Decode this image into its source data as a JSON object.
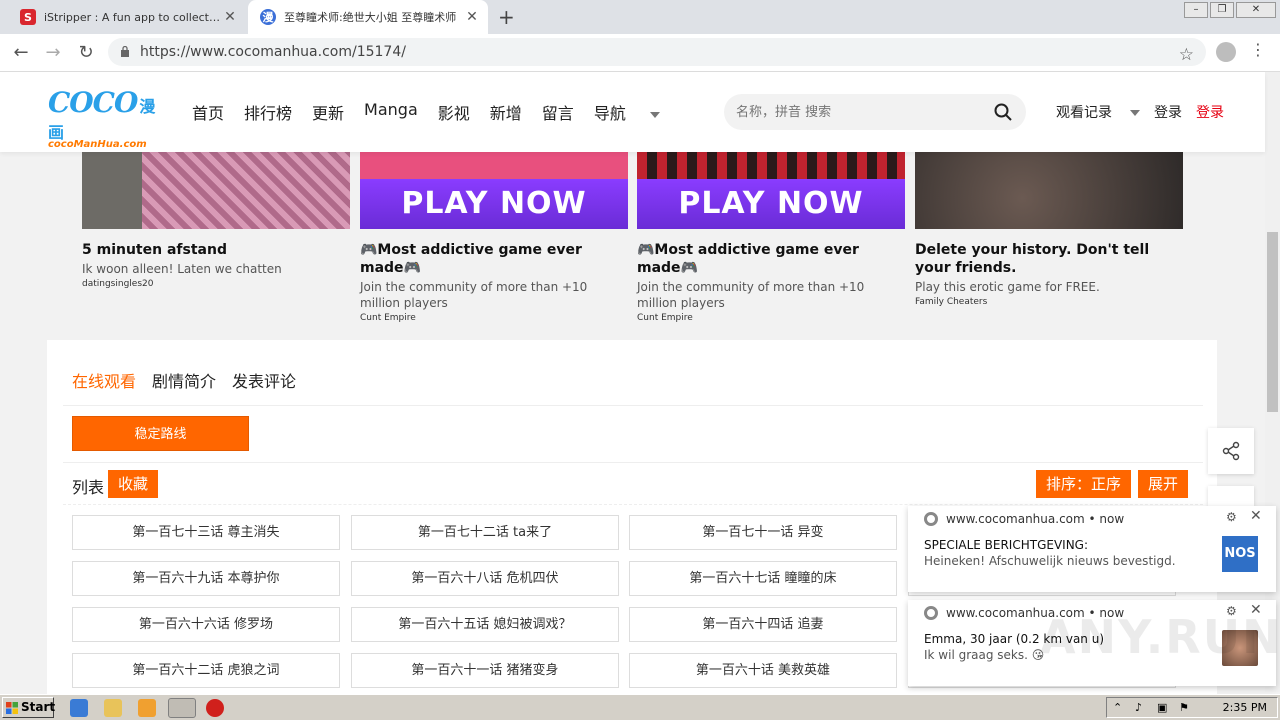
{
  "browser": {
    "tabs": [
      {
        "title": "iStripper : A fun app to collect and w",
        "active": false
      },
      {
        "title": "至尊瞳术师:绝世大小姐 至尊瞳术师",
        "active": true
      }
    ],
    "url": "https://www.cocomanhua.com/15174/"
  },
  "site": {
    "logo_main": "COCO",
    "logo_cn": "漫画",
    "logo_sub": "cocoManHua.com",
    "nav": [
      "首页",
      "排行榜",
      "更新",
      "Manga",
      "影视",
      "新增",
      "留言",
      "导航"
    ],
    "search_placeholder": "名称，拼音 搜索",
    "history_label": "观看记录",
    "login_label": "登录",
    "register_label": "登录"
  },
  "ads": [
    {
      "title": "5 minuten afstand",
      "desc": "Ik woon alleen! Laten we chatten",
      "source": "datingsingles20",
      "banner": ""
    },
    {
      "title": "🎮Most addictive game ever made🎮",
      "desc": "Join the community of more than +10 million players",
      "source": "Cunt Empire",
      "banner": "PLAY NOW"
    },
    {
      "title": "🎮Most addictive game ever made🎮",
      "desc": "Join the community of more than +10 million players",
      "source": "Cunt Empire",
      "banner": "PLAY NOW"
    },
    {
      "title": "Delete your history. Don't tell your friends.",
      "desc": "Play this erotic game for FREE.",
      "source": "Family Cheaters",
      "banner": ""
    }
  ],
  "panel": {
    "tabs": [
      "在线观看",
      "剧情简介",
      "发表评论"
    ],
    "route_button": "稳定路线",
    "list_label": "列表",
    "favorite_button": "收藏",
    "sort_button": "排序：正序",
    "expand_button": "展开",
    "episodes": [
      "第一百七十三话 尊主消失",
      "第一百七十二话 ta来了",
      "第一百七十一话 异变",
      "第一百六十九话 本尊护你",
      "第一百六十八话 危机四伏",
      "第一百六十七话 瞳瞳的床",
      "第一百六十六话 修罗场",
      "第一百六十五话 媳妇被调戏？",
      "第一百六十四话 追妻",
      "第一百六十二话 虎狼之词",
      "第一百六十一话 猪猪变身",
      "第一百六十话 美救英雄"
    ]
  },
  "notifications": [
    {
      "host": "www.cocomanhua.com • now",
      "heading": "SPECIALE BERICHTGEVING:",
      "body": "Heineken! Afschuwelijk nieuws bevestigd."
    },
    {
      "host": "www.cocomanhua.com • now",
      "heading": "Emma, 30 jaar (0.2 km van u)",
      "body": "Ik wil graag seks. 😘"
    }
  ],
  "taskbar": {
    "start_label": "Start",
    "time": "2:35 PM"
  },
  "watermark": "ANY.RUN"
}
